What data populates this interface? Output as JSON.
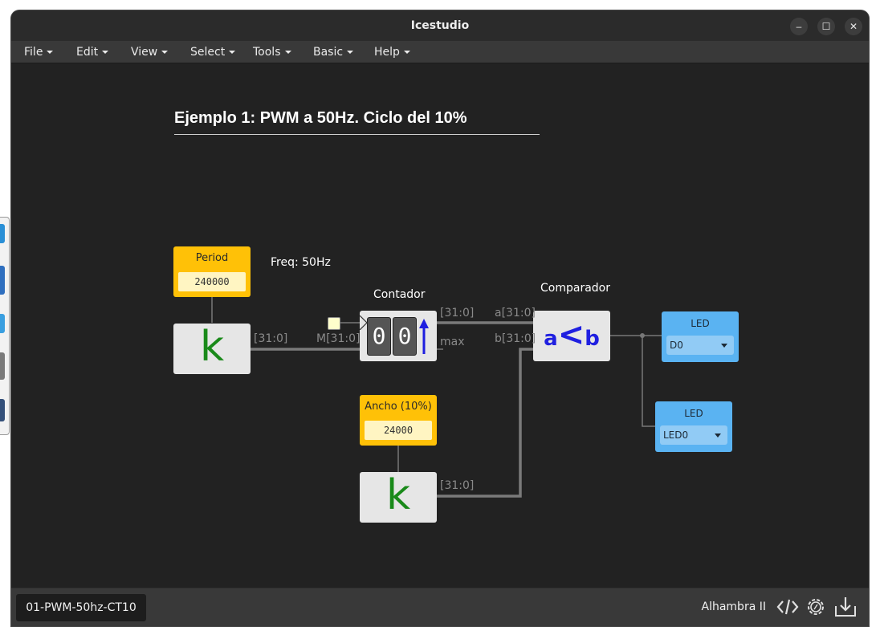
{
  "window": {
    "title": "Icestudio",
    "controls": {
      "minimize": "–",
      "maximize": "☐",
      "close": "✕"
    }
  },
  "menu": [
    {
      "label": "File"
    },
    {
      "label": "Edit"
    },
    {
      "label": "View"
    },
    {
      "label": "Select"
    },
    {
      "label": "Tools"
    },
    {
      "label": "Basic"
    },
    {
      "label": "Help"
    }
  ],
  "canvas": {
    "heading": "Ejemplo 1: PWM a 50Hz. Ciclo del 10%",
    "freq_note": "Freq: 50Hz",
    "period": {
      "title": "Period",
      "value": "240000"
    },
    "ancho": {
      "title": "Ancho (10%)",
      "value": "24000"
    },
    "k_symbol": "k",
    "counter": {
      "label": "Contador",
      "digits": [
        "0",
        "0"
      ],
      "in_port": "M[31:0]",
      "out_port": "[31:0]",
      "max_port": "max",
      "in_wire_label": "[31:0]"
    },
    "comparator": {
      "label": "Comparador",
      "a_port": "a[31:0]",
      "b_port": "b[31:0]",
      "symbol_a": "a",
      "symbol_op": "<",
      "symbol_b": "b"
    },
    "ancho_wire_label": "[31:0]",
    "led1": {
      "title": "LED",
      "pin": "D0"
    },
    "led2": {
      "title": "LED",
      "pin": "LED0"
    }
  },
  "statusbar": {
    "project": "01-PWM-50hz-CT10",
    "board": "Alhambra II",
    "icons": [
      "code-icon",
      "settings-gear-icon",
      "download-icon"
    ]
  },
  "colors": {
    "canvas_bg": "#222222",
    "param_yellow": "#ffc107",
    "led_blue": "#5ab3f2",
    "k_green": "#1a8a1a",
    "comparator_blue": "#1f1fe0"
  }
}
